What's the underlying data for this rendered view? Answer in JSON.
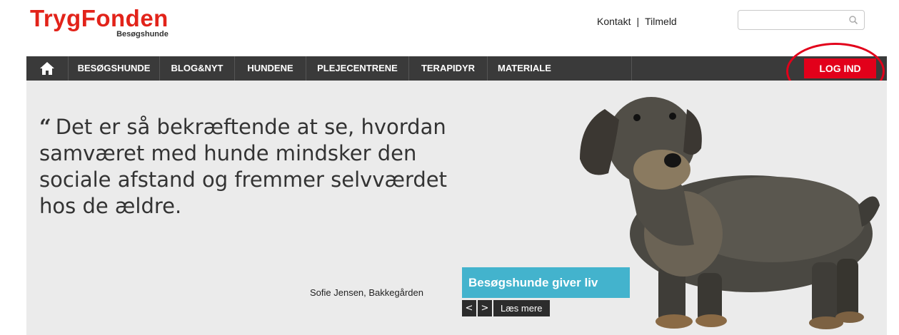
{
  "header": {
    "logo_text": "TrygFonden",
    "logo_subtext": "Besøgshunde",
    "links": {
      "contact": "Kontakt",
      "separator": "|",
      "signup": "Tilmeld"
    },
    "search": {
      "placeholder": "",
      "value": ""
    }
  },
  "nav": {
    "items": [
      {
        "label": "BESØGSHUNDE"
      },
      {
        "label": "BLOG&NYT"
      },
      {
        "label": "HUNDENE"
      },
      {
        "label": "PLEJECENTRENE"
      },
      {
        "label": "TERAPIDYR"
      },
      {
        "label": "MATERIALE"
      }
    ],
    "login_label": "LOG IND"
  },
  "hero": {
    "quote_mark": "“",
    "quote": "Det er så bekræftende at se, hvordan samværet med hunde mindsker den sociale afstand og fremmer selvværdet hos de ældre.",
    "author": "Sofie Jensen, Bakkegården",
    "banner_title": "Besøgshunde giver liv",
    "prev_label": "<",
    "next_label": ">",
    "read_more_label": "Læs mere"
  },
  "colors": {
    "brand_red": "#e2231a",
    "nav_bg": "#3a3a3a",
    "login_bg": "#e2001a",
    "banner_bg": "#43b3cd",
    "hero_bg": "#ebebeb"
  },
  "icons": [
    "home-icon",
    "search-icon",
    "chevron-left-icon",
    "chevron-right-icon"
  ]
}
